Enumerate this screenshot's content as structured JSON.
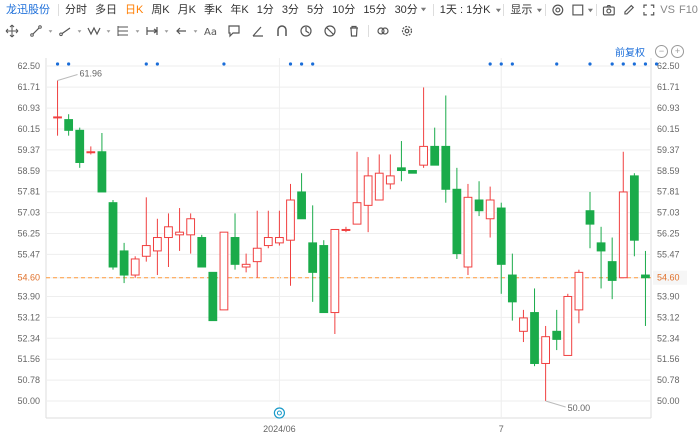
{
  "toolbar": {
    "stock_name": "龙迅股份",
    "periods": [
      "分时",
      "多日",
      "日K",
      "周K",
      "月K",
      "季K",
      "年K",
      "1分",
      "3分",
      "5分",
      "10分",
      "15分",
      "30分"
    ],
    "active_period": "日K",
    "range_select": "1天 : 1分K",
    "display_label": "显示",
    "vs_label": "VS",
    "f10_label": "F10"
  },
  "adjust_label": "前复权",
  "zoom": {
    "minus": "−",
    "plus": "+"
  },
  "colors": {
    "up": "#f04040",
    "down": "#1aab4a",
    "ref": "#ff9a3c",
    "grid": "#eeeeee",
    "axis_text": "#666666",
    "price_tag_bg": "#f6f6f6"
  },
  "chart_data": {
    "type": "candlestick",
    "y_ticks": [
      "62.50",
      "61.71",
      "60.93",
      "60.15",
      "59.37",
      "58.59",
      "57.81",
      "57.03",
      "56.25",
      "55.47",
      "54.60",
      "53.90",
      "53.12",
      "52.34",
      "51.56",
      "50.78",
      "50.00"
    ],
    "ylim": [
      49.6,
      62.5
    ],
    "ref_price": "54.60",
    "x_labels": [
      {
        "label": "2024/06",
        "index": 20
      },
      {
        "label": "7",
        "index": 40
      }
    ],
    "max_label": "61.96",
    "min_label": "50.00",
    "markers_top": [
      0,
      1,
      8,
      9,
      15,
      21,
      22,
      23,
      39,
      40,
      41,
      45,
      48,
      50,
      51,
      52,
      53,
      54
    ],
    "event_marker_index": 20,
    "candles": [
      {
        "o": 60.6,
        "h": 61.96,
        "l": 59.9,
        "c": 60.6
      },
      {
        "o": 60.5,
        "h": 60.7,
        "l": 59.9,
        "c": 60.1
      },
      {
        "o": 60.1,
        "h": 60.2,
        "l": 58.7,
        "c": 58.9
      },
      {
        "o": 59.3,
        "h": 59.5,
        "l": 59.2,
        "c": 59.3
      },
      {
        "o": 59.3,
        "h": 60.0,
        "l": 57.8,
        "c": 57.8
      },
      {
        "o": 57.4,
        "h": 57.5,
        "l": 54.9,
        "c": 55.0
      },
      {
        "o": 55.6,
        "h": 55.9,
        "l": 54.4,
        "c": 54.7
      },
      {
        "o": 54.7,
        "h": 55.4,
        "l": 54.6,
        "c": 55.3
      },
      {
        "o": 55.4,
        "h": 57.6,
        "l": 55.2,
        "c": 55.8
      },
      {
        "o": 55.6,
        "h": 56.8,
        "l": 54.7,
        "c": 56.1
      },
      {
        "o": 56.1,
        "h": 57.0,
        "l": 55.0,
        "c": 56.5
      },
      {
        "o": 56.2,
        "h": 57.2,
        "l": 55.6,
        "c": 56.3
      },
      {
        "o": 56.2,
        "h": 57.0,
        "l": 55.5,
        "c": 56.8
      },
      {
        "o": 56.1,
        "h": 56.2,
        "l": 55.0,
        "c": 55.0
      },
      {
        "o": 54.8,
        "h": 54.8,
        "l": 53.0,
        "c": 53.0
      },
      {
        "o": 53.4,
        "h": 56.3,
        "l": 53.4,
        "c": 56.3
      },
      {
        "o": 56.1,
        "h": 57.0,
        "l": 54.9,
        "c": 55.1
      },
      {
        "o": 55.0,
        "h": 55.5,
        "l": 54.8,
        "c": 55.1
      },
      {
        "o": 55.2,
        "h": 57.1,
        "l": 54.6,
        "c": 55.7
      },
      {
        "o": 55.8,
        "h": 57.1,
        "l": 55.7,
        "c": 56.1
      },
      {
        "o": 55.9,
        "h": 57.1,
        "l": 55.8,
        "c": 56.1
      },
      {
        "o": 56.0,
        "h": 58.1,
        "l": 54.3,
        "c": 57.5
      },
      {
        "o": 57.8,
        "h": 58.5,
        "l": 56.8,
        "c": 56.8
      },
      {
        "o": 55.9,
        "h": 57.3,
        "l": 53.7,
        "c": 54.8
      },
      {
        "o": 55.8,
        "h": 56.0,
        "l": 53.3,
        "c": 53.3
      },
      {
        "o": 53.3,
        "h": 56.4,
        "l": 52.5,
        "c": 56.4
      },
      {
        "o": 56.4,
        "h": 56.5,
        "l": 56.3,
        "c": 56.4
      },
      {
        "o": 56.6,
        "h": 59.3,
        "l": 56.6,
        "c": 57.4
      },
      {
        "o": 57.3,
        "h": 59.1,
        "l": 56.3,
        "c": 58.4
      },
      {
        "o": 57.5,
        "h": 59.2,
        "l": 57.5,
        "c": 58.5
      },
      {
        "o": 58.1,
        "h": 59.2,
        "l": 57.9,
        "c": 58.4
      },
      {
        "o": 58.7,
        "h": 59.7,
        "l": 58.2,
        "c": 58.6
      },
      {
        "o": 58.6,
        "h": 58.6,
        "l": 58.5,
        "c": 58.5
      },
      {
        "o": 58.8,
        "h": 61.7,
        "l": 58.7,
        "c": 59.5
      },
      {
        "o": 59.5,
        "h": 60.2,
        "l": 58.8,
        "c": 58.8
      },
      {
        "o": 59.5,
        "h": 61.4,
        "l": 57.4,
        "c": 57.9
      },
      {
        "o": 57.9,
        "h": 58.7,
        "l": 55.3,
        "c": 55.5
      },
      {
        "o": 55.0,
        "h": 58.1,
        "l": 54.7,
        "c": 57.6
      },
      {
        "o": 57.5,
        "h": 58.2,
        "l": 56.9,
        "c": 57.1
      },
      {
        "o": 56.8,
        "h": 58.0,
        "l": 56.1,
        "c": 57.5
      },
      {
        "o": 57.2,
        "h": 57.4,
        "l": 54.0,
        "c": 55.1
      },
      {
        "o": 54.7,
        "h": 55.5,
        "l": 53.0,
        "c": 53.7
      },
      {
        "o": 52.6,
        "h": 53.4,
        "l": 52.2,
        "c": 53.1
      },
      {
        "o": 53.3,
        "h": 54.2,
        "l": 51.3,
        "c": 51.4
      },
      {
        "o": 51.4,
        "h": 52.8,
        "l": 50.0,
        "c": 52.4
      },
      {
        "o": 52.6,
        "h": 53.4,
        "l": 51.9,
        "c": 52.3
      },
      {
        "o": 51.7,
        "h": 54.0,
        "l": 51.7,
        "c": 53.9
      },
      {
        "o": 53.4,
        "h": 54.9,
        "l": 52.9,
        "c": 54.8
      },
      {
        "o": 57.1,
        "h": 57.8,
        "l": 55.7,
        "c": 56.6
      },
      {
        "o": 55.9,
        "h": 56.5,
        "l": 54.2,
        "c": 55.6
      },
      {
        "o": 55.2,
        "h": 56.1,
        "l": 53.8,
        "c": 54.5
      },
      {
        "o": 54.6,
        "h": 59.3,
        "l": 54.6,
        "c": 57.8
      },
      {
        "o": 58.4,
        "h": 58.5,
        "l": 55.4,
        "c": 56.0
      },
      {
        "o": 54.7,
        "h": 55.6,
        "l": 52.8,
        "c": 54.6
      }
    ]
  }
}
